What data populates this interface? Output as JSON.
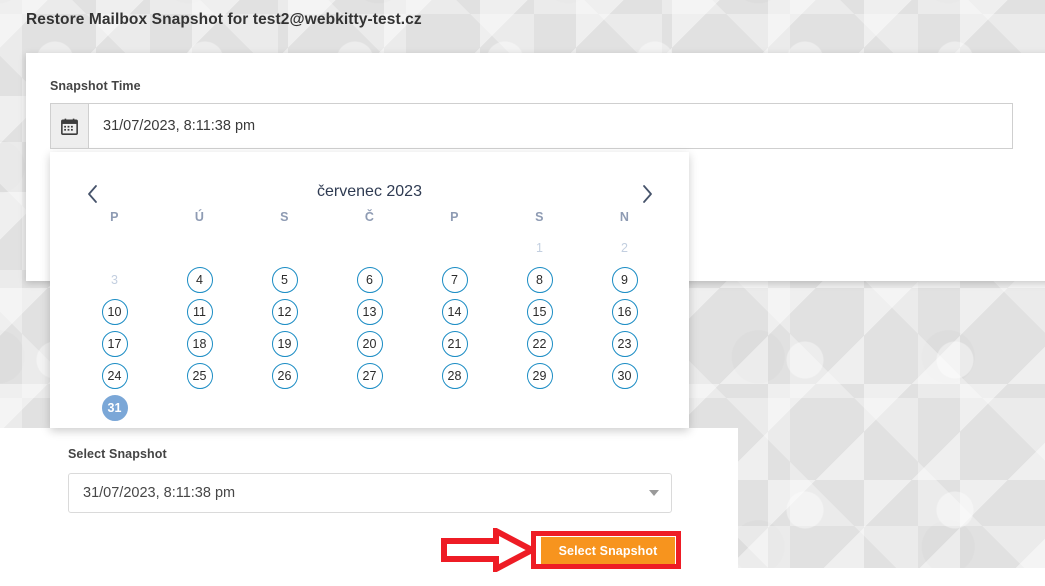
{
  "page": {
    "title": "Restore Mailbox Snapshot for test2@webkitty-test.cz",
    "background_color": "#e1e1e1"
  },
  "form": {
    "snapshot_time": {
      "label": "Snapshot Time",
      "value": "31/07/2023, 8:11:38 pm",
      "prefix_icon": "calendar-icon"
    },
    "select_snapshot": {
      "label": "Select Snapshot",
      "value": "31/07/2023, 8:11:38 pm",
      "caret_icon": "chevron-down-icon"
    },
    "submit_button": {
      "label": "Select Snapshot",
      "color": "#f7941e",
      "text_color": "#ffffff"
    }
  },
  "calendar": {
    "prev_icon": "chevron-left-icon",
    "next_icon": "chevron-right-icon",
    "month_label": "červenec 2023",
    "weekdays": [
      "P",
      "Ú",
      "S",
      "Č",
      "P",
      "S",
      "N"
    ],
    "accent_color": "#1a8cc4",
    "selected_color": "#7ba7d7",
    "disabled_color": "#c3cfe0",
    "cells": [
      {
        "label": "",
        "state": "empty"
      },
      {
        "label": "",
        "state": "empty"
      },
      {
        "label": "",
        "state": "empty"
      },
      {
        "label": "",
        "state": "empty"
      },
      {
        "label": "",
        "state": "empty"
      },
      {
        "label": "1",
        "state": "disabled"
      },
      {
        "label": "2",
        "state": "disabled"
      },
      {
        "label": "3",
        "state": "disabled"
      },
      {
        "label": "4",
        "state": "enabled"
      },
      {
        "label": "5",
        "state": "enabled"
      },
      {
        "label": "6",
        "state": "enabled"
      },
      {
        "label": "7",
        "state": "enabled"
      },
      {
        "label": "8",
        "state": "enabled"
      },
      {
        "label": "9",
        "state": "enabled"
      },
      {
        "label": "10",
        "state": "enabled"
      },
      {
        "label": "11",
        "state": "enabled"
      },
      {
        "label": "12",
        "state": "enabled"
      },
      {
        "label": "13",
        "state": "enabled"
      },
      {
        "label": "14",
        "state": "enabled"
      },
      {
        "label": "15",
        "state": "enabled"
      },
      {
        "label": "16",
        "state": "enabled"
      },
      {
        "label": "17",
        "state": "enabled"
      },
      {
        "label": "18",
        "state": "enabled"
      },
      {
        "label": "19",
        "state": "enabled"
      },
      {
        "label": "20",
        "state": "enabled"
      },
      {
        "label": "21",
        "state": "enabled"
      },
      {
        "label": "22",
        "state": "enabled"
      },
      {
        "label": "23",
        "state": "enabled"
      },
      {
        "label": "24",
        "state": "enabled"
      },
      {
        "label": "25",
        "state": "enabled"
      },
      {
        "label": "26",
        "state": "enabled"
      },
      {
        "label": "27",
        "state": "enabled"
      },
      {
        "label": "28",
        "state": "enabled"
      },
      {
        "label": "29",
        "state": "enabled"
      },
      {
        "label": "30",
        "state": "enabled"
      },
      {
        "label": "31",
        "state": "selected"
      },
      {
        "label": "",
        "state": "empty"
      },
      {
        "label": "",
        "state": "empty"
      },
      {
        "label": "",
        "state": "empty"
      },
      {
        "label": "",
        "state": "empty"
      },
      {
        "label": "",
        "state": "empty"
      },
      {
        "label": "",
        "state": "empty"
      }
    ]
  },
  "annotations": {
    "highlight_color": "#ee1c25",
    "arrow_icon": "right-arrow-annotation",
    "box_icon": "highlight-box-annotation"
  }
}
